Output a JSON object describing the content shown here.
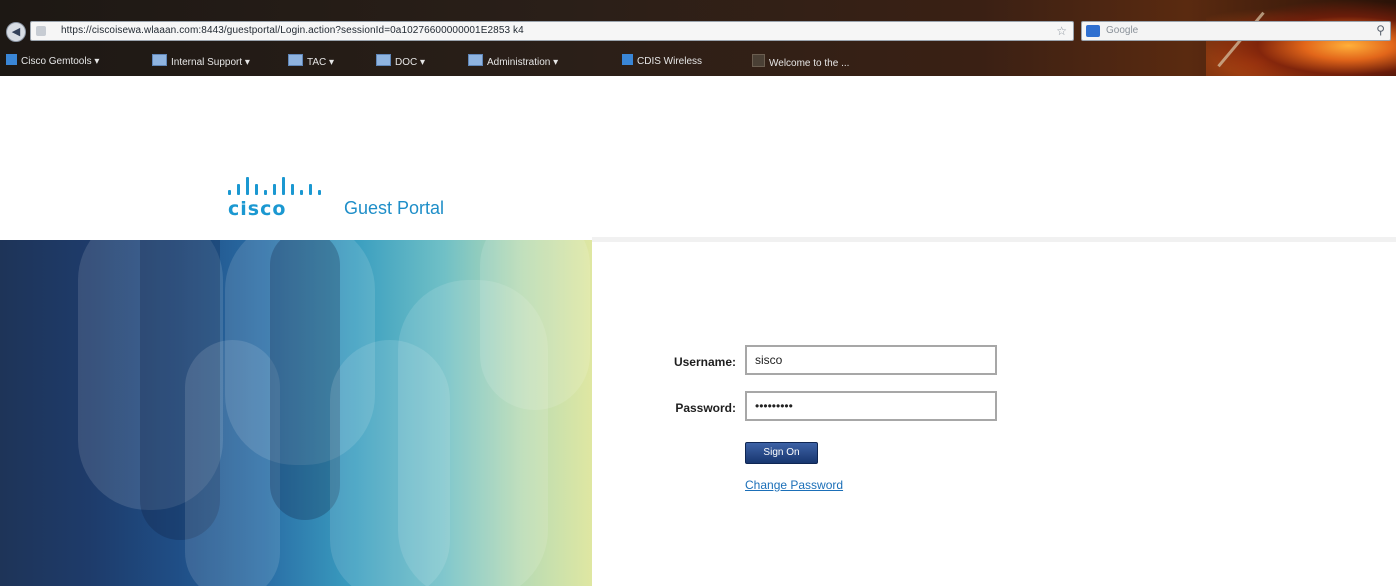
{
  "browser": {
    "back_icon": "◀",
    "url": "https://ciscoisewa.wlaaan.com:8443/guestportal/Login.action?sessionId=0a10276600000001E2853 k4",
    "bookmark_star_icon": "☆",
    "search_placeholder": "Google",
    "search_icon": "⚲",
    "bookmarks": [
      {
        "label": "Cisco Gemtools ▾"
      },
      {
        "label": "Internal Support ▾"
      },
      {
        "label": "TAC ▾"
      },
      {
        "label": "DOC ▾"
      },
      {
        "label": "Administration ▾"
      },
      {
        "label": "CDIS Wireless"
      },
      {
        "label": "Welcome to the ..."
      }
    ]
  },
  "header": {
    "logo_text": "cisco",
    "title": "Guest Portal"
  },
  "login": {
    "username_label": "Username:",
    "username_value": "sisco",
    "password_label": "Password:",
    "password_value": "•••••••••",
    "signon_label": "Sign On",
    "change_password_label": "Change Password"
  },
  "colors": {
    "cisco_blue": "#1b98d1",
    "button_navy": "#18366f",
    "link_blue": "#1b6fb8"
  }
}
